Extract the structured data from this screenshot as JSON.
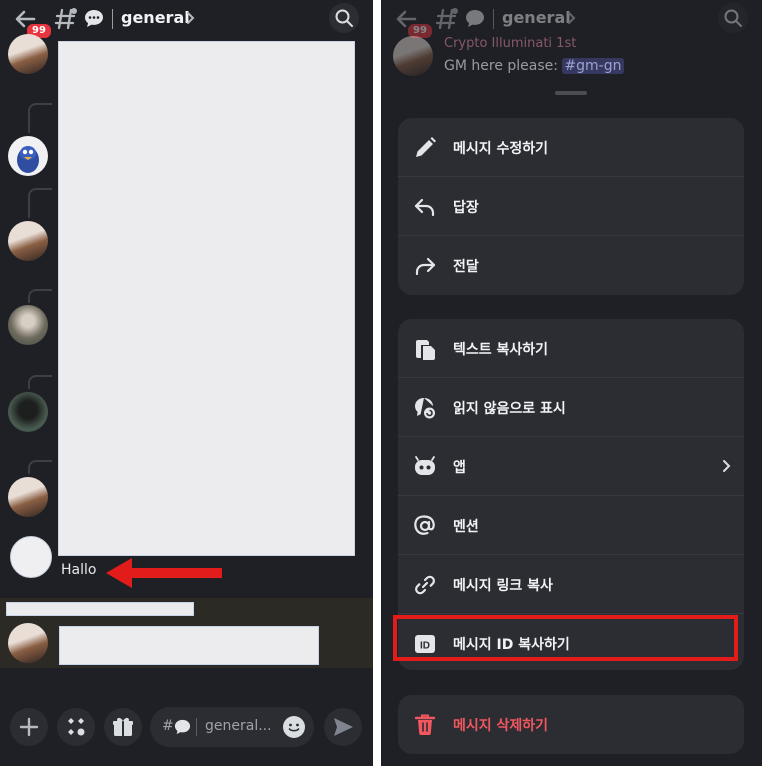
{
  "header": {
    "badge": "99",
    "channel_name": "general"
  },
  "left_chat": {
    "message_text": "Hallo",
    "input_placeholder": "general...",
    "input_prefix": "#"
  },
  "right_background": {
    "author_line": "Crypto Illuminati 1st",
    "message": "GM here please:",
    "channel_tag": "#gm-gn"
  },
  "menu": {
    "group1": [
      "메시지 수정하기",
      "답장",
      "전달"
    ],
    "group2": [
      "텍스트 복사하기",
      "읽지 않음으로 표시",
      "앱",
      "멘션",
      "메시지 링크 복사",
      "메시지 ID 복사하기"
    ],
    "delete": "메시지 삭제하기"
  },
  "colors": {
    "background": "#1f2026",
    "card": "#2b2d33",
    "danger": "#f2575f",
    "highlight_box": "#e21b1b",
    "badge": "#e8343e"
  },
  "icons": [
    "back-arrow-icon",
    "channel-hash-icon",
    "speech-bubble-icon",
    "search-icon",
    "plus-icon",
    "apps-icon",
    "gift-icon",
    "emoji-icon",
    "send-icon",
    "pencil-icon",
    "reply-icon",
    "forward-icon",
    "copy-text-icon",
    "mark-unread-icon",
    "app-bot-icon",
    "mention-icon",
    "link-icon",
    "id-icon",
    "trash-icon"
  ]
}
